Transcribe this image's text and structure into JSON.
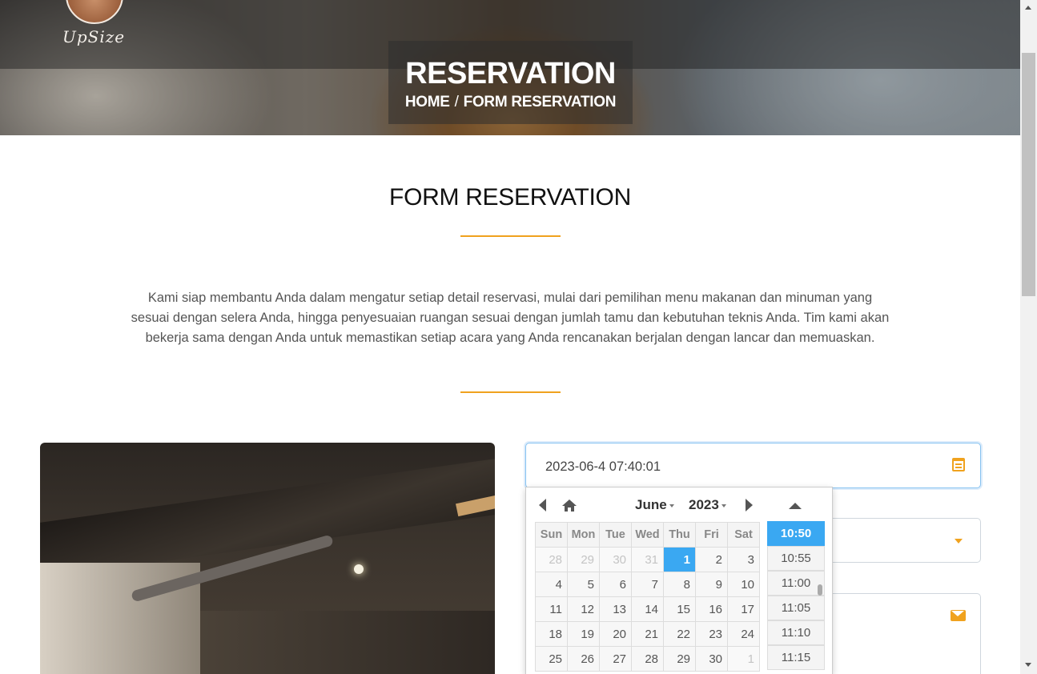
{
  "hero": {
    "logo_text": "UpSize",
    "title": "RESERVATION",
    "breadcrumb_home": "HOME",
    "breadcrumb_separator": "/",
    "breadcrumb_current": "FORM RESERVATION"
  },
  "section": {
    "title": "FORM RESERVATION",
    "intro": "Kami siap membantu Anda dalam mengatur setiap detail reservasi, mulai dari pemilihan menu makanan dan minuman yang sesuai dengan selera Anda, hingga penyesuaian ruangan sesuai dengan jumlah tamu dan kebutuhan teknis Anda. Tim kami akan bekerja sama dengan Anda untuk memastikan setiap acara yang Anda rencanakan berjalan dengan lancar dan memuaskan."
  },
  "form": {
    "datetime_value": "2023-06-4 07:40:01",
    "icons": {
      "datetime": "calendar-icon",
      "select": "caret-down-icon",
      "email": "envelope-icon"
    }
  },
  "picker": {
    "month": "June",
    "year": "2023",
    "weekdays": [
      "Sun",
      "Mon",
      "Tue",
      "Wed",
      "Thu",
      "Fri",
      "Sat"
    ],
    "weeks": [
      [
        "28",
        "29",
        "30",
        "31",
        "1",
        "2",
        "3"
      ],
      [
        "4",
        "5",
        "6",
        "7",
        "8",
        "9",
        "10"
      ],
      [
        "11",
        "12",
        "13",
        "14",
        "15",
        "16",
        "17"
      ],
      [
        "18",
        "19",
        "20",
        "21",
        "22",
        "23",
        "24"
      ],
      [
        "25",
        "26",
        "27",
        "28",
        "29",
        "30",
        "1"
      ]
    ],
    "selected_day": "1",
    "times": [
      "10:50",
      "10:55",
      "11:00",
      "11:05",
      "11:10",
      "11:15"
    ],
    "selected_time": "10:50",
    "accent": "#3aa8f2"
  },
  "theme": {
    "accent": "#f0a21e"
  }
}
